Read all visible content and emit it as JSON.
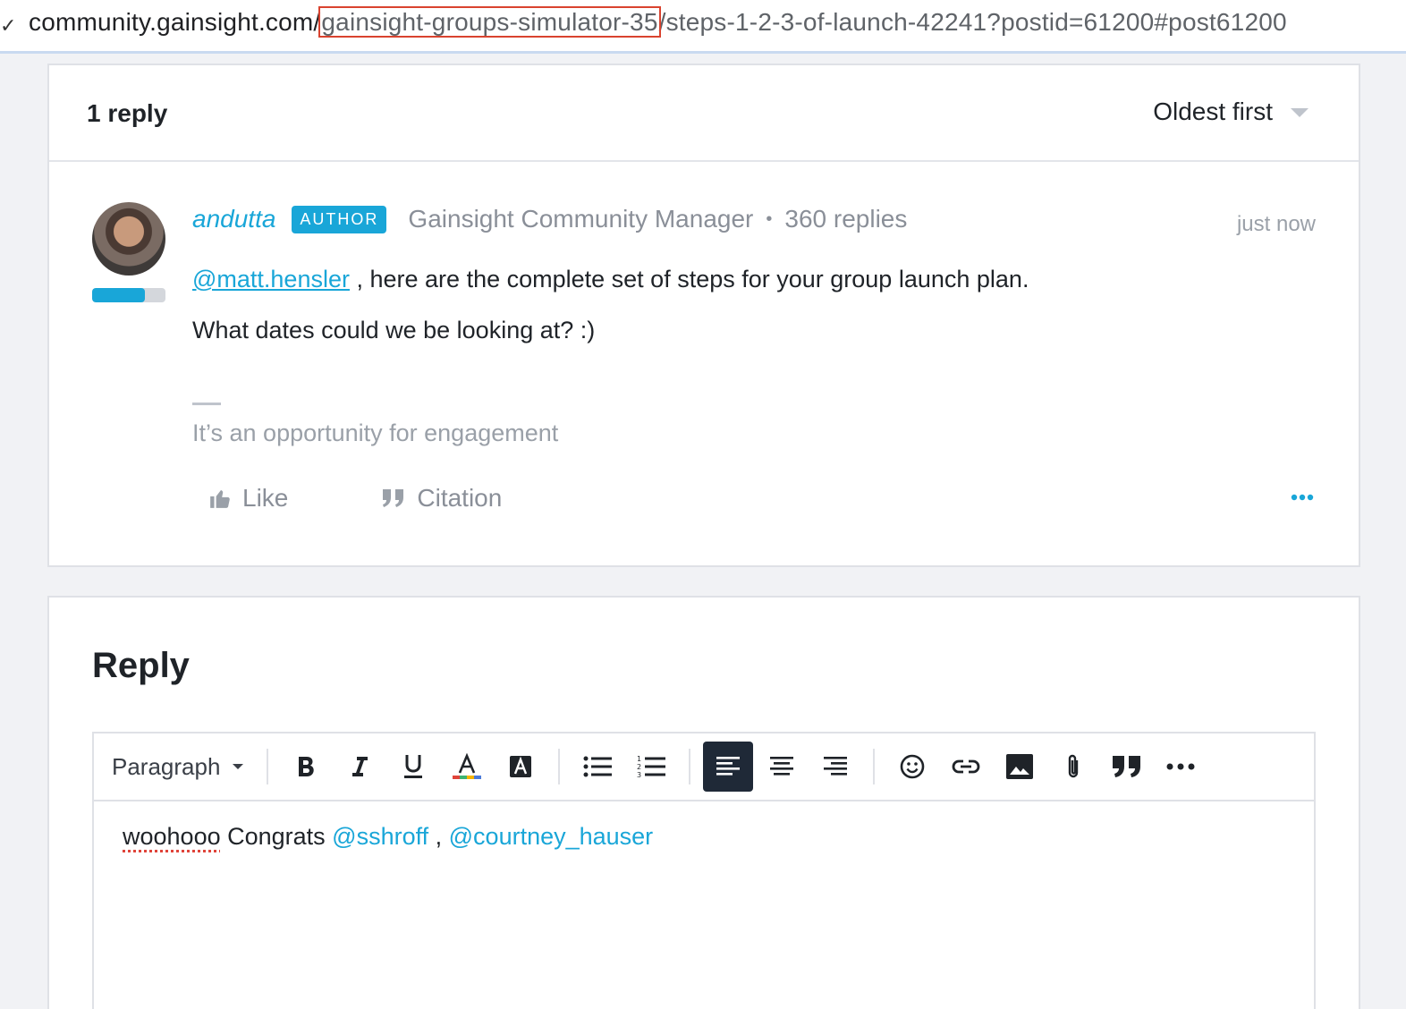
{
  "browser": {
    "url_prefix": "community.gainsight.com/",
    "url_highlight": "gainsight-groups-simulator-35",
    "url_suffix": "/steps-1-2-3-of-launch-42241?postid=61200#post61200"
  },
  "replies": {
    "count_label": "1 reply",
    "sort_label": "Oldest first"
  },
  "post": {
    "author": "andutta",
    "badge": "AUTHOR",
    "role": "Gainsight Community Manager",
    "separator": "•",
    "reply_count": "360 replies",
    "timestamp": "just now",
    "rank_progress": 0.72,
    "mention": "@matt.hensler",
    "line1_rest": ", here are the complete set of steps for your group launch plan.",
    "line2": "What dates could we be looking at? :)",
    "signature": "It’s an opportunity for engagement",
    "like_label": "Like",
    "citation_label": "Citation"
  },
  "reply_editor": {
    "title": "Reply",
    "format_label": "Paragraph",
    "content": {
      "word1": "woohooo",
      "text1": " Congrats ",
      "mention1": "@sshroff",
      "text2": " , ",
      "mention2": "@courtney_hauser"
    }
  },
  "colors": {
    "accent": "#19a6d8",
    "muted_text": "#8a8f98",
    "active_toolbar": "#1f2937",
    "highlight_box": "#d9432f"
  }
}
